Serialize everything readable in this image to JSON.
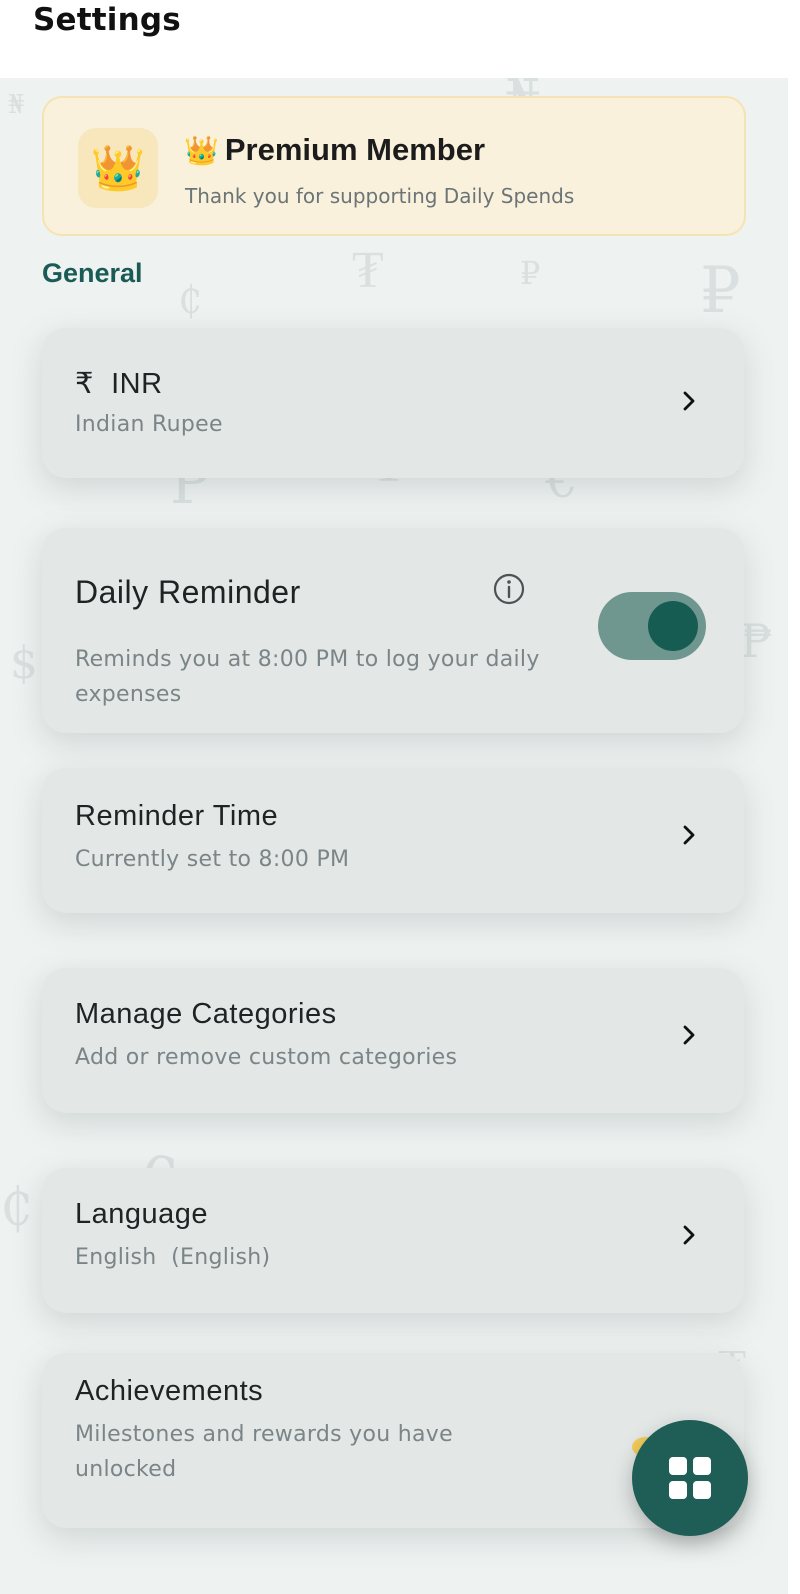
{
  "header": {
    "title": "Settings"
  },
  "premium": {
    "emoji": "👑",
    "title": "Premium Member",
    "subtitle": "Thank you for supporting Daily Spends"
  },
  "section": {
    "general_label": "General"
  },
  "items": {
    "currency": {
      "symbol": "₹",
      "code": "INR",
      "name": "Indian Rupee"
    },
    "daily_reminder": {
      "title": "Daily Reminder",
      "subtitle": "Reminds you at 8:00 PM to log your daily expenses",
      "toggle_on": true
    },
    "reminder_time": {
      "title": "Reminder Time",
      "subtitle": "Currently set to 8:00 PM"
    },
    "categories": {
      "title": "Manage Categories",
      "subtitle": "Add or remove custom categories"
    },
    "language": {
      "title": "Language",
      "subtitle": "English  (English)"
    },
    "achievements": {
      "title": "Achievements",
      "subtitle": "Milestones and rewards you have unlocked"
    }
  },
  "icons": {
    "chevron": "chevron-right-icon",
    "info": "info-icon",
    "fab": "grid-icon"
  },
  "colors": {
    "accent": "#1e5e56",
    "section_label": "#1a5c55",
    "toggle_track": "#6f9790",
    "premium_bg": "#f9f1dc"
  }
}
